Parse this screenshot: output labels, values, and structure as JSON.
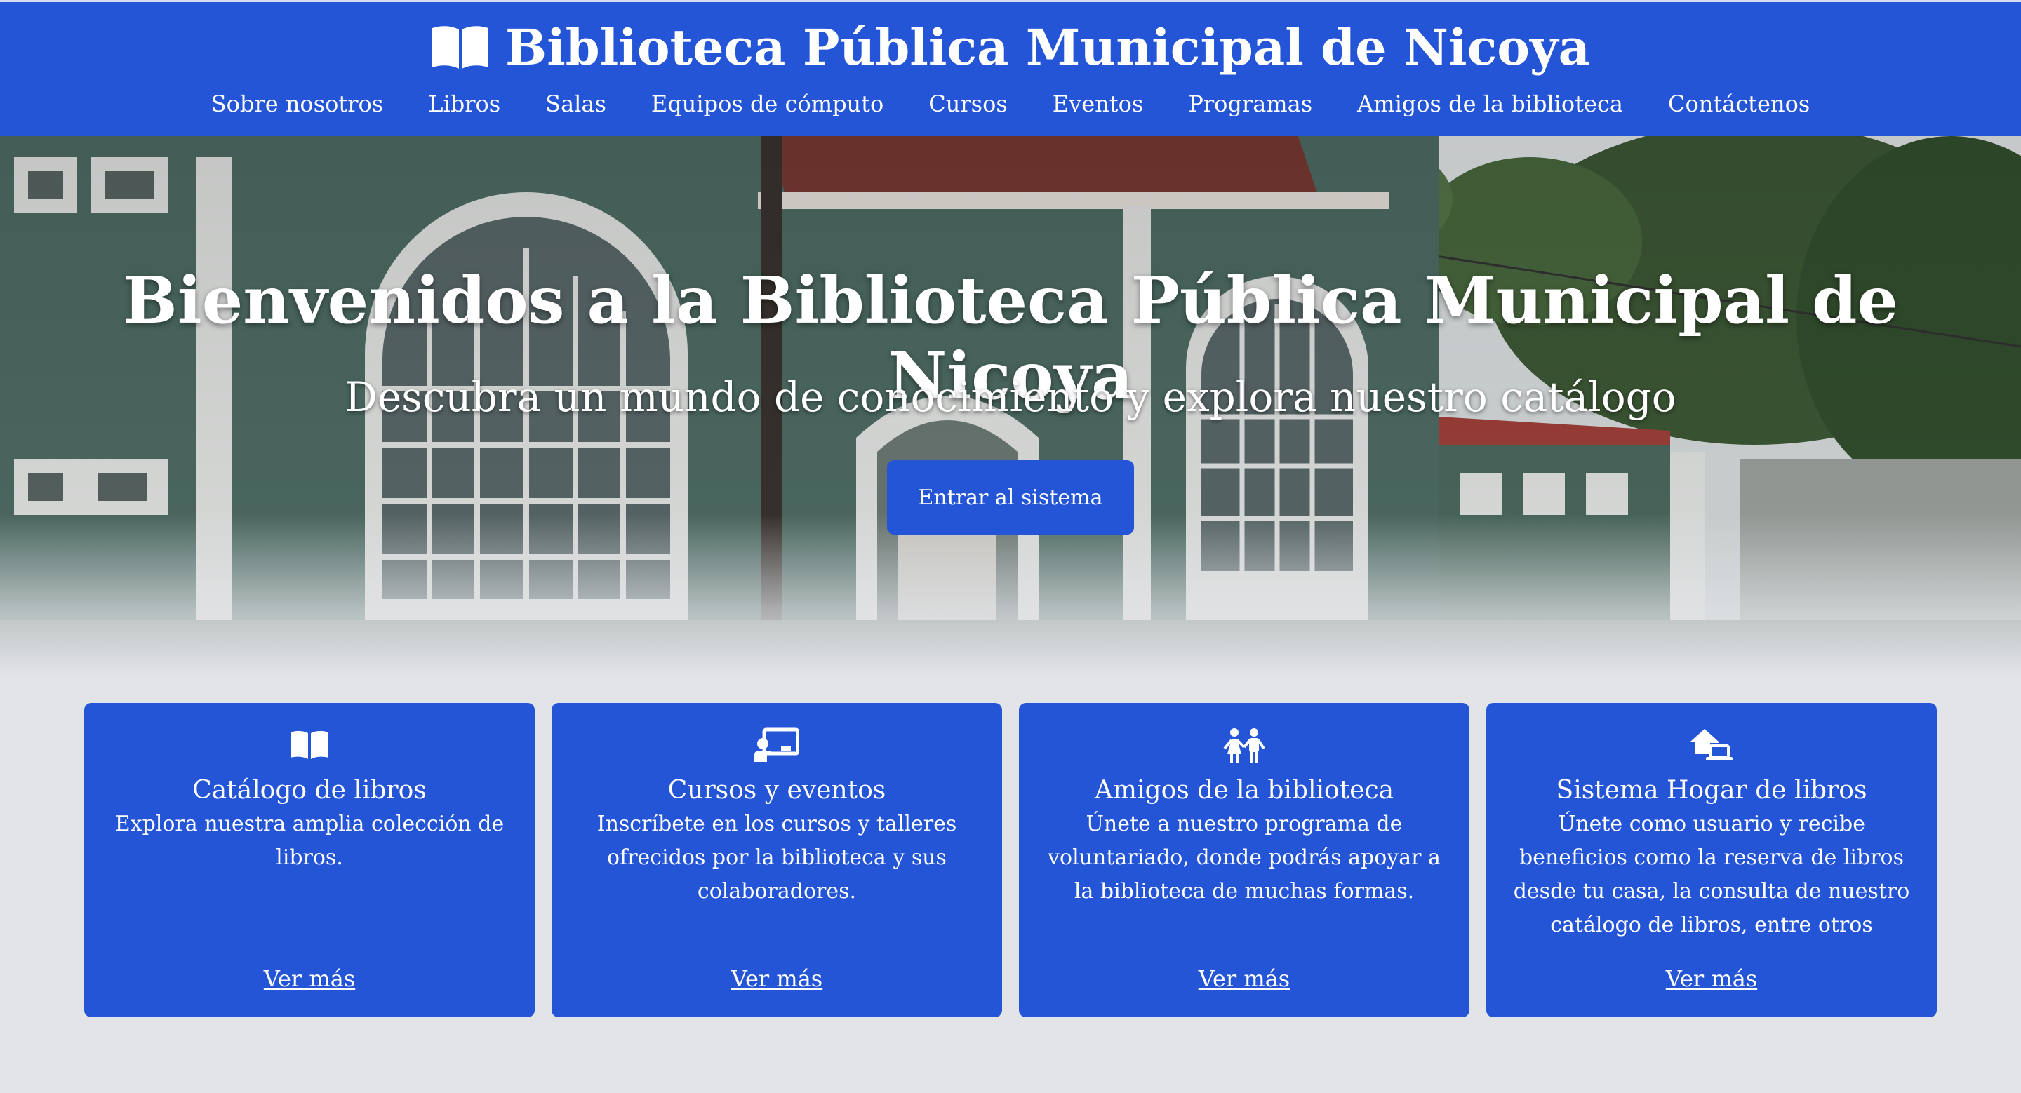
{
  "header": {
    "title": "Biblioteca Pública Municipal de Nicoya",
    "logo_icon": "book-open-icon",
    "nav": [
      {
        "label": "Sobre nosotros"
      },
      {
        "label": "Libros"
      },
      {
        "label": "Salas"
      },
      {
        "label": "Equipos de cómputo"
      },
      {
        "label": "Cursos"
      },
      {
        "label": "Eventos"
      },
      {
        "label": "Programas"
      },
      {
        "label": "Amigos de la biblioteca"
      },
      {
        "label": "Contáctenos"
      }
    ]
  },
  "hero": {
    "title": "Bienvenidos a la Biblioteca Pública Municipal de Nicoya",
    "subtitle": "Descubra un mundo de conocimiento y explora nuestro catálogo",
    "button_label": "Entrar al sistema"
  },
  "cards": [
    {
      "icon": "book-open-icon",
      "title": "Catálogo de libros",
      "description": "Explora nuestra amplia colección de libros.",
      "link": "Ver más"
    },
    {
      "icon": "chalkboard-teacher-icon",
      "title": "Cursos y eventos",
      "description": "Inscríbete en los cursos y talleres ofrecidos por la biblioteca y sus colaboradores.",
      "link": "Ver más"
    },
    {
      "icon": "children-icon",
      "title": "Amigos de la biblioteca",
      "description": "Únete a nuestro programa de voluntariado, donde podrás apoyar a la biblioteca de muchas formas.",
      "link": "Ver más"
    },
    {
      "icon": "house-laptop-icon",
      "title": "Sistema Hogar de libros",
      "description": "Únete como usuario y recibe beneficios como la reserva de libros desde tu casa, la consulta de nuestro catálogo de libros, entre otros",
      "link": "Ver más"
    }
  ],
  "colors": {
    "primary": "#2355d6",
    "background": "#e2e4e8",
    "text_light": "#ffffff"
  }
}
